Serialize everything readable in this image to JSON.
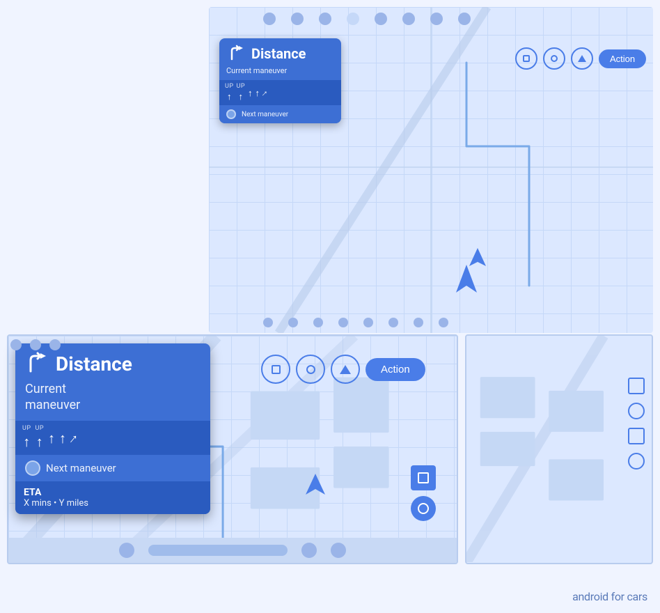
{
  "app": {
    "brand": "android",
    "brand_suffix": "for cars"
  },
  "small_nav": {
    "distance": "Distance",
    "current_maneuver": "Current maneuver",
    "next_maneuver": "Next maneuver",
    "lane_labels": [
      "UP",
      "UP",
      "",
      "",
      ""
    ],
    "action_button": "Action"
  },
  "large_nav": {
    "distance": "Distance",
    "current_maneuver": "Current\nmaneuver",
    "next_maneuver": "Next maneuver",
    "eta_title": "ETA",
    "eta_details": "X mins • Y miles",
    "lane_labels": [
      "UP",
      "UP",
      "",
      "",
      ""
    ],
    "action_button": "Action"
  },
  "icons": {
    "turn_right": "↱",
    "arrow_up": "↑",
    "arrow_right_turn": "↱"
  },
  "colors": {
    "nav_card": "#3d6fd4",
    "nav_card_dark": "#2a5bbf",
    "map_bg": "#dce8ff",
    "action_btn": "#4a7de8"
  }
}
